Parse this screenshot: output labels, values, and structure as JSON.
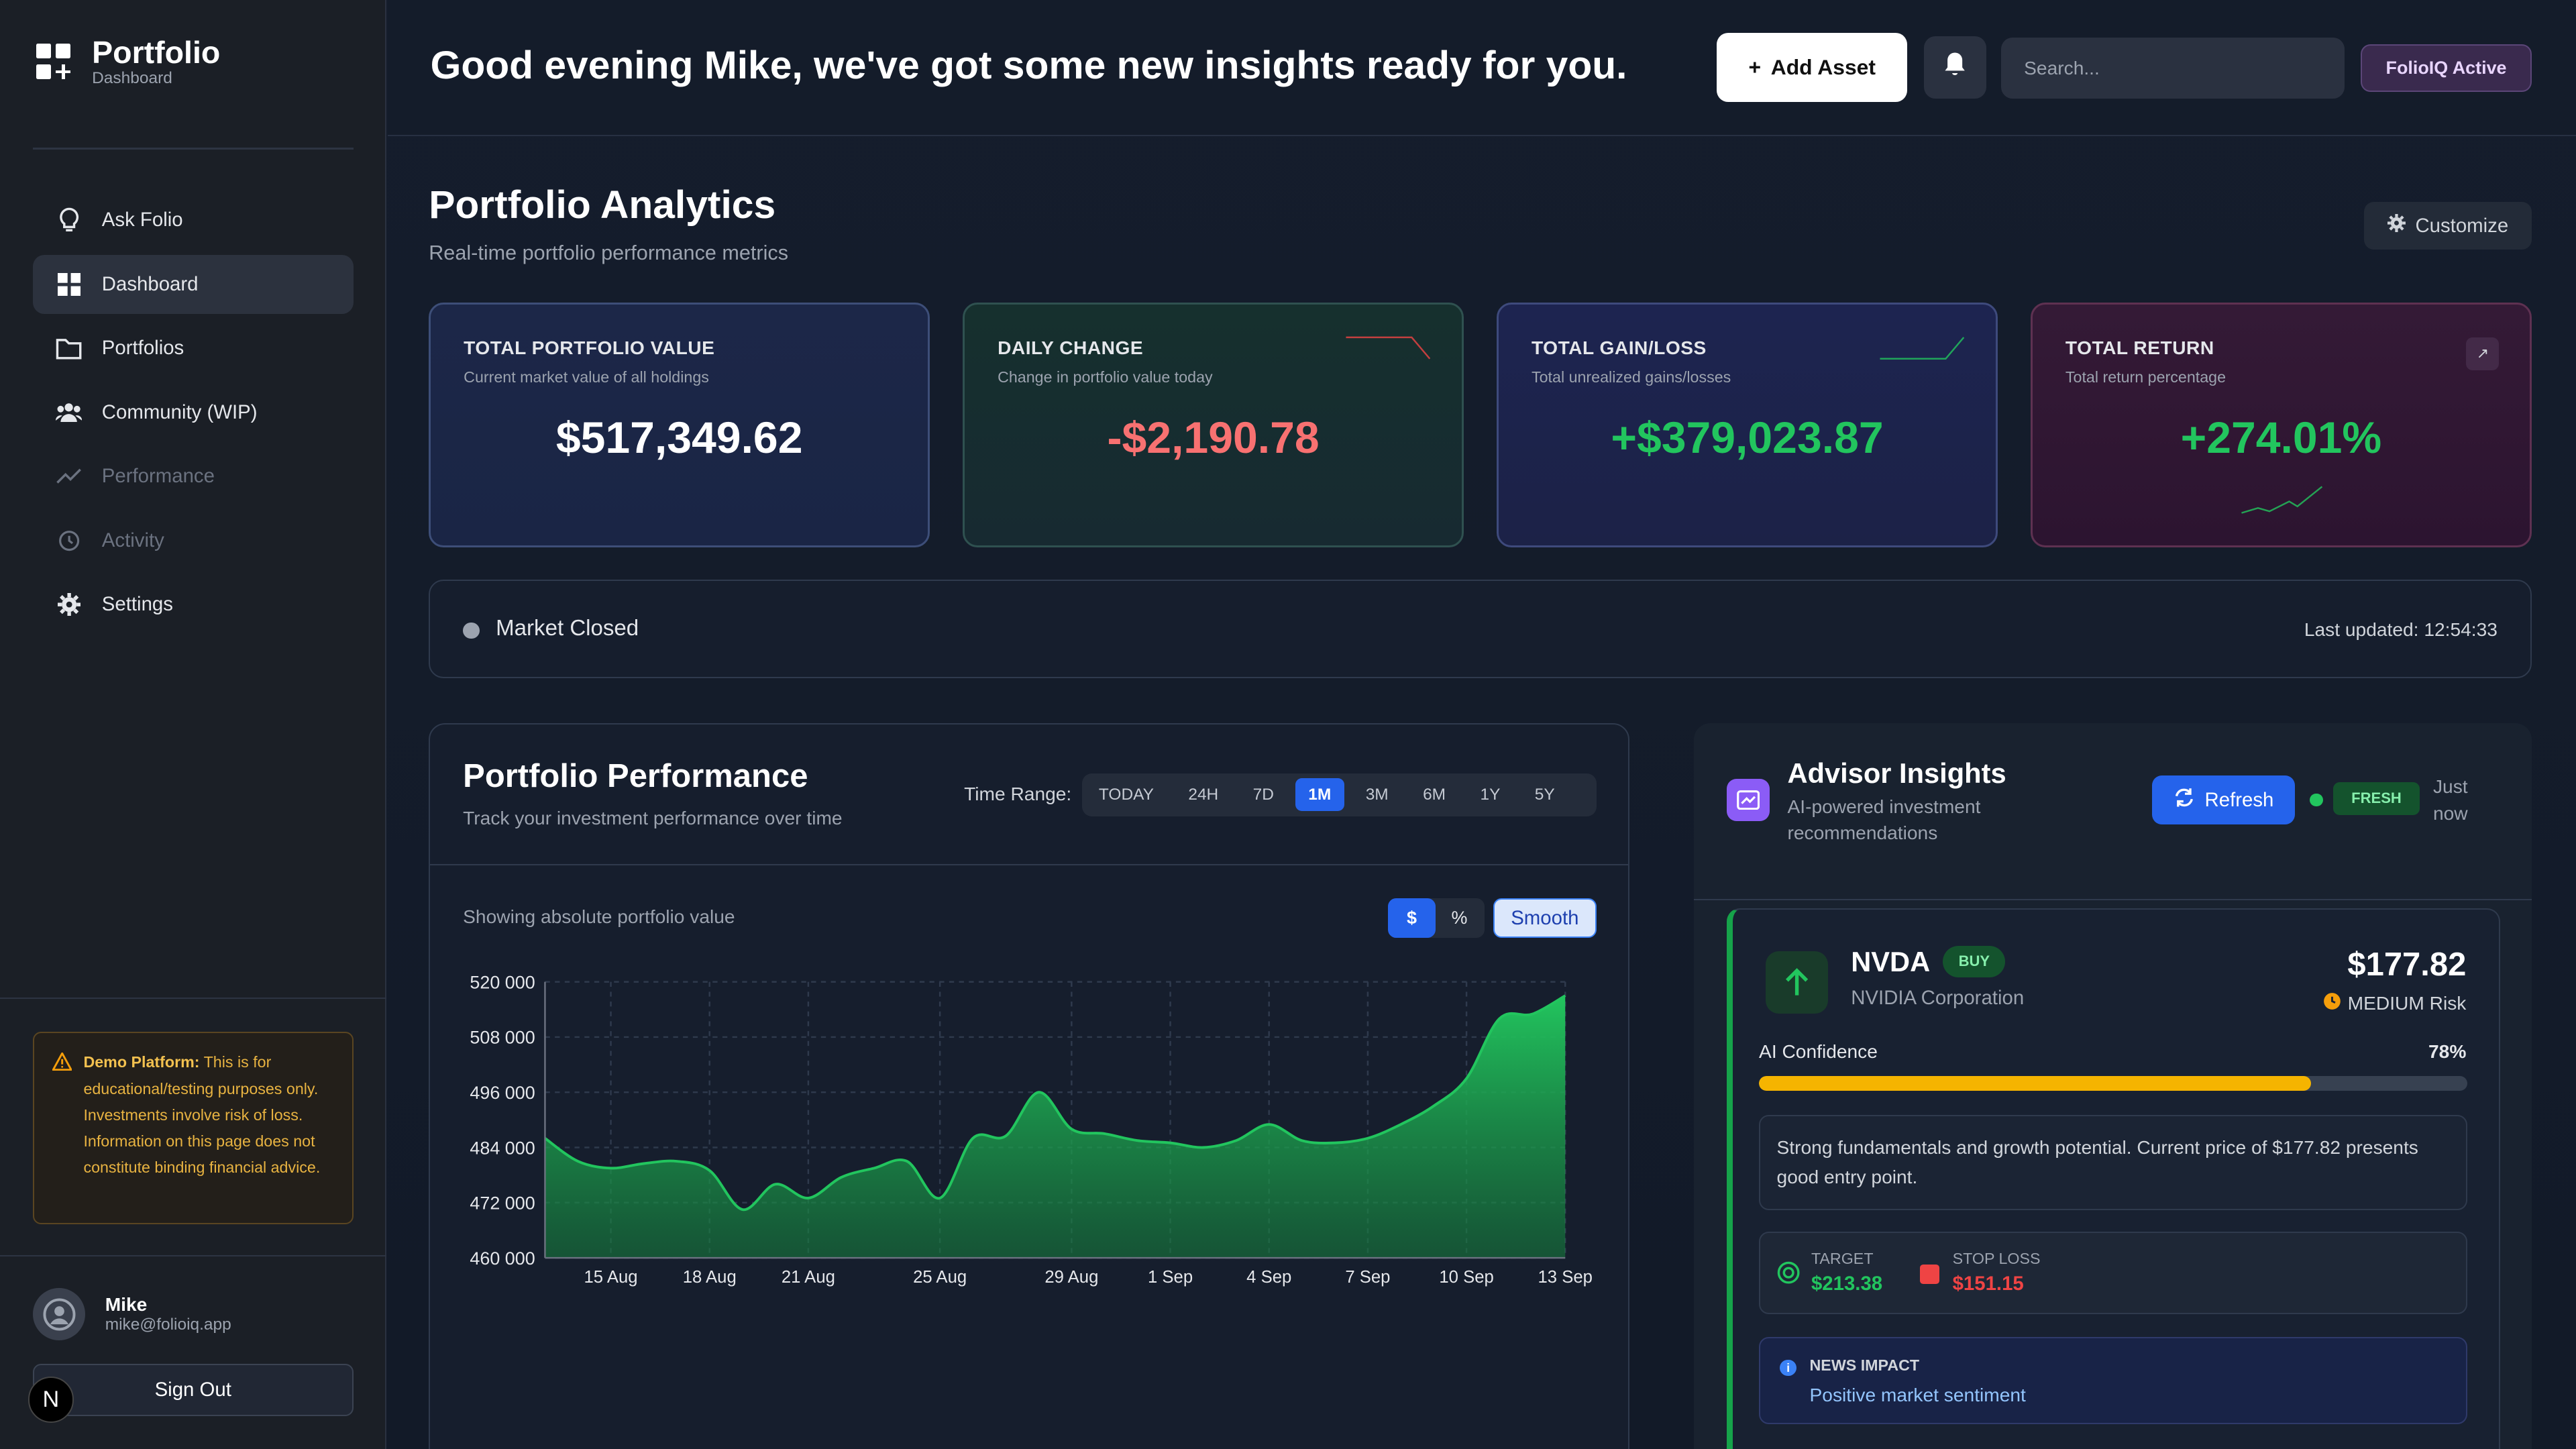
{
  "brand": {
    "title": "Portfolio",
    "subtitle": "Dashboard"
  },
  "sidebar": {
    "items": [
      {
        "label": "Ask Folio",
        "icon": "lightbulb-icon",
        "active": false,
        "disabled": false
      },
      {
        "label": "Dashboard",
        "icon": "grid-icon",
        "active": true,
        "disabled": false
      },
      {
        "label": "Portfolios",
        "icon": "folder-icon",
        "active": false,
        "disabled": false
      },
      {
        "label": "Community (WIP)",
        "icon": "users-icon",
        "active": false,
        "disabled": false
      },
      {
        "label": "Performance",
        "icon": "trending-icon",
        "active": false,
        "disabled": true
      },
      {
        "label": "Activity",
        "icon": "history-icon",
        "active": false,
        "disabled": true
      },
      {
        "label": "Settings",
        "icon": "gear-icon",
        "active": false,
        "disabled": false
      }
    ],
    "disclaimer_title": "Demo Platform:",
    "disclaimer_text": " This is for educational/testing purposes only. Investments involve risk of loss. Information on this page does not constitute binding financial advice.",
    "user": {
      "name": "Mike",
      "email": "mike@folioiq.app"
    },
    "signout_label": "Sign Out",
    "n_badge": "N"
  },
  "header": {
    "greeting": "Good evening Mike, we've got some new insights ready for you.",
    "add_asset_label": "Add Asset",
    "search_placeholder": "Search...",
    "status_label": "FolioIQ Active"
  },
  "analytics": {
    "title": "Portfolio Analytics",
    "subtitle": "Real-time portfolio performance metrics",
    "customize_label": "Customize",
    "cards": [
      {
        "title": "TOTAL PORTFOLIO VALUE",
        "subtitle": "Current market value of all holdings",
        "value": "$517,349.62",
        "color": "#ffffff"
      },
      {
        "title": "DAILY CHANGE",
        "subtitle": "Change in portfolio value today",
        "value": "-$2,190.78",
        "color": "#f87171"
      },
      {
        "title": "TOTAL GAIN/LOSS",
        "subtitle": "Total unrealized gains/losses",
        "value": "+$379,023.87",
        "color": "#22c55e"
      },
      {
        "title": "TOTAL RETURN",
        "subtitle": "Total return percentage",
        "value": "+274.01%",
        "color": "#22c55e"
      }
    ]
  },
  "market": {
    "status": "Market Closed",
    "last_updated": "Last updated: 12:54:33"
  },
  "performance": {
    "title": "Portfolio Performance",
    "subtitle": "Track your investment performance over time",
    "time_range_label": "Time Range:",
    "ranges": [
      "TODAY",
      "24H",
      "7D",
      "1M",
      "3M",
      "6M",
      "1Y",
      "5Y"
    ],
    "active_range": "1M",
    "showing_text": "Showing absolute portfolio value",
    "unit_options": [
      "$",
      "%"
    ],
    "active_unit": "$",
    "smooth_label": "Smooth"
  },
  "chart_data": {
    "type": "area",
    "title": "",
    "xlabel": "",
    "ylabel": "",
    "ylim": [
      460000,
      520000
    ],
    "yticks": [
      "520 000",
      "508 000",
      "496 000",
      "484 000",
      "472 000",
      "460 000"
    ],
    "xticks": [
      "15 Aug",
      "18 Aug",
      "21 Aug",
      "25 Aug",
      "29 Aug",
      "1 Sep",
      "4 Sep",
      "7 Sep",
      "10 Sep",
      "13 Sep"
    ],
    "color": "#22c55e",
    "x": [
      "13 Aug",
      "14 Aug",
      "15 Aug",
      "16 Aug",
      "17 Aug",
      "18 Aug",
      "19 Aug",
      "20 Aug",
      "21 Aug",
      "22 Aug",
      "23 Aug",
      "24 Aug",
      "25 Aug",
      "26 Aug",
      "27 Aug",
      "28 Aug",
      "29 Aug",
      "30 Aug",
      "31 Aug",
      "1 Sep",
      "2 Sep",
      "3 Sep",
      "4 Sep",
      "5 Sep",
      "6 Sep",
      "7 Sep",
      "8 Sep",
      "9 Sep",
      "10 Sep",
      "11 Sep",
      "12 Sep",
      "13 Sep"
    ],
    "values": [
      486000,
      481000,
      479500,
      480500,
      481000,
      479000,
      470500,
      476000,
      473000,
      477500,
      479500,
      481000,
      473000,
      486000,
      486500,
      496000,
      488000,
      487000,
      485500,
      485000,
      484000,
      485500,
      489000,
      485500,
      485000,
      486000,
      489000,
      493000,
      499000,
      512000,
      513000,
      517000
    ]
  },
  "advisor": {
    "title": "Advisor Insights",
    "subtitle": "AI-powered investment recommendations",
    "refresh_label": "Refresh",
    "fresh_label": "FRESH",
    "time_label": "Just now",
    "stock": {
      "ticker": "NVDA",
      "action": "BUY",
      "company": "NVIDIA Corporation",
      "price": "$177.82",
      "risk": "MEDIUM Risk",
      "confidence_label": "AI Confidence",
      "confidence_text": "78%",
      "confidence": 0.78,
      "reason": "Strong fundamentals and growth potential. Current price of $177.82 presents good entry point.",
      "target_label": "TARGET",
      "target_value": "$213.38",
      "stop_label": "STOP LOSS",
      "stop_value": "$151.15",
      "news_label": "NEWS IMPACT",
      "news_text": "Positive market sentiment"
    }
  }
}
